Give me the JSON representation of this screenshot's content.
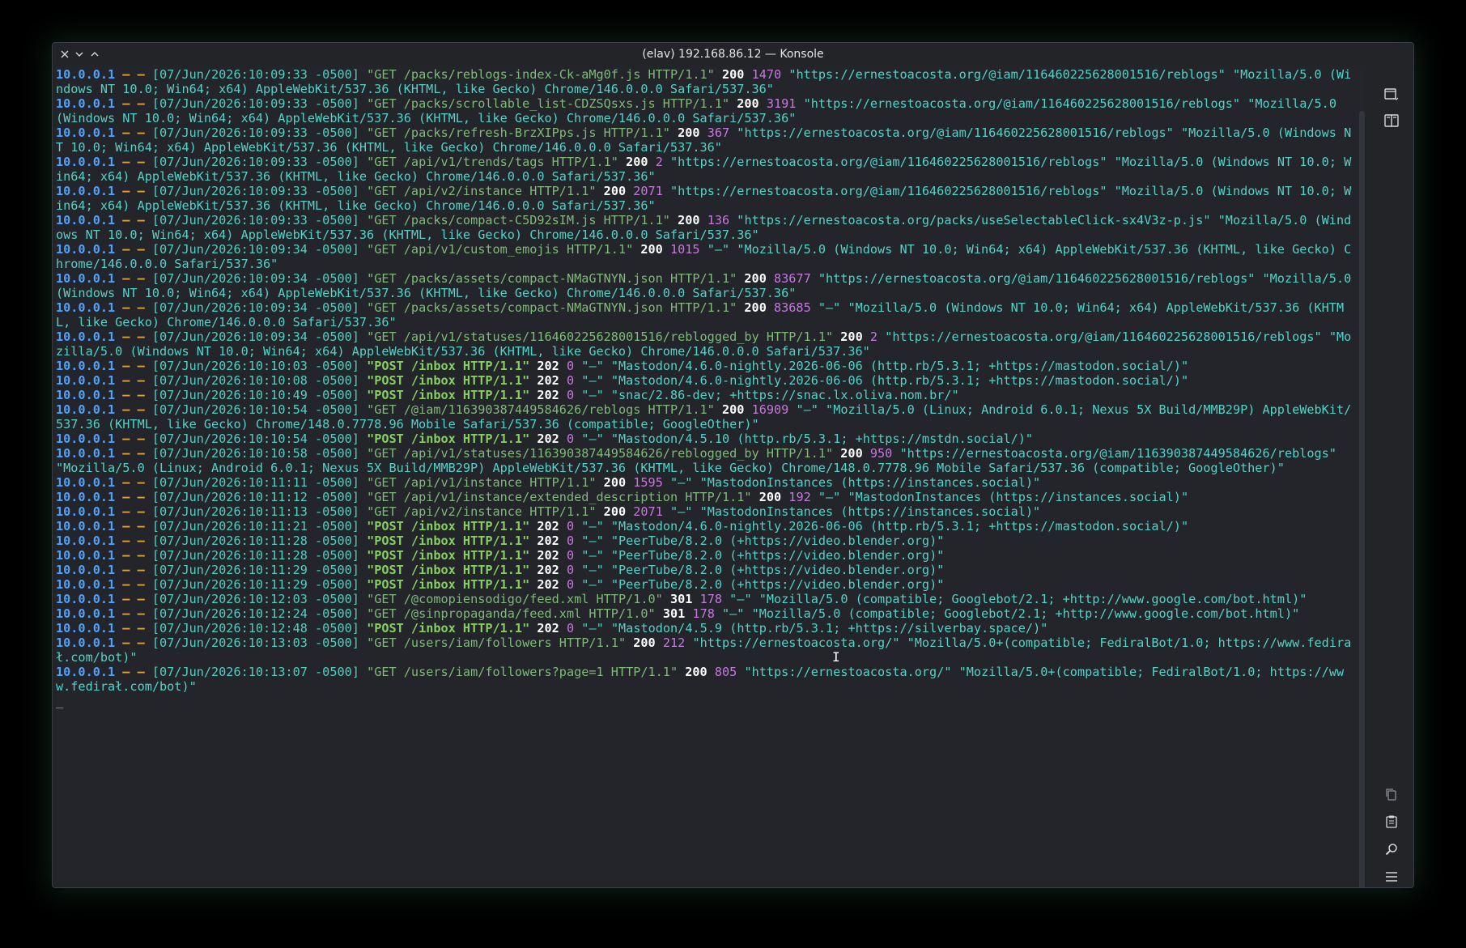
{
  "window": {
    "title": "(elav) 192.168.86.12 — Konsole"
  },
  "log_lines": [
    {
      "ip": "10.0.0.1",
      "sep": " – – ",
      "ts": "[07/Jun/2026:10:09:33 -0500]",
      "req": "\"GET /packs/reblogs-index-Ck-aMg0f.js HTTP/1.1\"",
      "method": "GET",
      "status": "200",
      "size": "1470",
      "ref": "\"https://ernestoacosta.org/@iam/116460225628001516/reblogs\"",
      "ua": "\"Mozilla/5.0 (Windows NT 10.0; Win64; x64) AppleWebKit/537.36 (KHTML, like Gecko) Chrome/146.0.0.0 Safari/537.36\""
    },
    {
      "ip": "10.0.0.1",
      "sep": " – – ",
      "ts": "[07/Jun/2026:10:09:33 -0500]",
      "req": "\"GET /packs/scrollable_list-CDZSQsxs.js HTTP/1.1\"",
      "method": "GET",
      "status": "200",
      "size": "3191",
      "ref": "\"https://ernestoacosta.org/@iam/116460225628001516/reblogs\"",
      "ua": "\"Mozilla/5.0 (Windows NT 10.0; Win64; x64) AppleWebKit/537.36 (KHTML, like Gecko) Chrome/146.0.0.0 Safari/537.36\""
    },
    {
      "ip": "10.0.0.1",
      "sep": " – – ",
      "ts": "[07/Jun/2026:10:09:33 -0500]",
      "req": "\"GET /packs/refresh-BrzXIPps.js HTTP/1.1\"",
      "method": "GET",
      "status": "200",
      "size": "367",
      "ref": "\"https://ernestoacosta.org/@iam/116460225628001516/reblogs\"",
      "ua": "\"Mozilla/5.0 (Windows NT 10.0; Win64; x64) AppleWebKit/537.36 (KHTML, like Gecko) Chrome/146.0.0.0 Safari/537.36\""
    },
    {
      "ip": "10.0.0.1",
      "sep": " – – ",
      "ts": "[07/Jun/2026:10:09:33 -0500]",
      "req": "\"GET /api/v1/trends/tags HTTP/1.1\"",
      "method": "GET",
      "status": "200",
      "size": "2",
      "ref": "\"https://ernestoacosta.org/@iam/116460225628001516/reblogs\"",
      "ua": "\"Mozilla/5.0 (Windows NT 10.0; Win64; x64) AppleWebKit/537.36 (KHTML, like Gecko) Chrome/146.0.0.0 Safari/537.36\""
    },
    {
      "ip": "10.0.0.1",
      "sep": " – – ",
      "ts": "[07/Jun/2026:10:09:33 -0500]",
      "req": "\"GET /api/v2/instance HTTP/1.1\"",
      "method": "GET",
      "status": "200",
      "size": "2071",
      "ref": "\"https://ernestoacosta.org/@iam/116460225628001516/reblogs\"",
      "ua": "\"Mozilla/5.0 (Windows NT 10.0; Win64; x64) AppleWebKit/537.36 (KHTML, like Gecko) Chrome/146.0.0.0 Safari/537.36\""
    },
    {
      "ip": "10.0.0.1",
      "sep": " – – ",
      "ts": "[07/Jun/2026:10:09:33 -0500]",
      "req": "\"GET /packs/compact-C5D92sIM.js HTTP/1.1\"",
      "method": "GET",
      "status": "200",
      "size": "136",
      "ref": "\"https://ernestoacosta.org/packs/useSelectableClick-sx4V3z-p.js\"",
      "ua": "\"Mozilla/5.0 (Windows NT 10.0; Win64; x64) AppleWebKit/537.36 (KHTML, like Gecko) Chrome/146.0.0.0 Safari/537.36\""
    },
    {
      "ip": "10.0.0.1",
      "sep": " – – ",
      "ts": "[07/Jun/2026:10:09:34 -0500]",
      "req": "\"GET /api/v1/custom_emojis HTTP/1.1\"",
      "method": "GET",
      "status": "200",
      "size": "1015",
      "ref": "\"–\"",
      "ua": "\"Mozilla/5.0 (Windows NT 10.0; Win64; x64) AppleWebKit/537.36 (KHTML, like Gecko) Chrome/146.0.0.0 Safari/537.36\""
    },
    {
      "ip": "10.0.0.1",
      "sep": " – – ",
      "ts": "[07/Jun/2026:10:09:34 -0500]",
      "req": "\"GET /packs/assets/compact-NMaGTNYN.json HTTP/1.1\"",
      "method": "GET",
      "status": "200",
      "size": "83677",
      "ref": "\"https://ernestoacosta.org/@iam/116460225628001516/reblogs\"",
      "ua": "\"Mozilla/5.0 (Windows NT 10.0; Win64; x64) AppleWebKit/537.36 (KHTML, like Gecko) Chrome/146.0.0.0 Safari/537.36\""
    },
    {
      "ip": "10.0.0.1",
      "sep": " – – ",
      "ts": "[07/Jun/2026:10:09:34 -0500]",
      "req": "\"GET /packs/assets/compact-NMaGTNYN.json HTTP/1.1\"",
      "method": "GET",
      "status": "200",
      "size": "83685",
      "ref": "\"–\"",
      "ua": "\"Mozilla/5.0 (Windows NT 10.0; Win64; x64) AppleWebKit/537.36 (KHTML, like Gecko) Chrome/146.0.0.0 Safari/537.36\""
    },
    {
      "ip": "10.0.0.1",
      "sep": " – – ",
      "ts": "[07/Jun/2026:10:09:34 -0500]",
      "req": "\"GET /api/v1/statuses/116460225628001516/reblogged_by HTTP/1.1\"",
      "method": "GET",
      "status": "200",
      "size": "2",
      "ref": "\"https://ernestoacosta.org/@iam/116460225628001516/reblogs\"",
      "ua": "\"Mozilla/5.0 (Windows NT 10.0; Win64; x64) AppleWebKit/537.36 (KHTML, like Gecko) Chrome/146.0.0.0 Safari/537.36\""
    },
    {
      "ip": "10.0.0.1",
      "sep": " – – ",
      "ts": "[07/Jun/2026:10:10:03 -0500]",
      "req": "\"POST /inbox HTTP/1.1\"",
      "method": "POST",
      "status": "202",
      "size": "0",
      "ref": "\"–\"",
      "ua": "\"Mastodon/4.6.0-nightly.2026-06-06 (http.rb/5.3.1; +https://mastodon.social/)\""
    },
    {
      "ip": "10.0.0.1",
      "sep": " – – ",
      "ts": "[07/Jun/2026:10:10:08 -0500]",
      "req": "\"POST /inbox HTTP/1.1\"",
      "method": "POST",
      "status": "202",
      "size": "0",
      "ref": "\"–\"",
      "ua": "\"Mastodon/4.6.0-nightly.2026-06-06 (http.rb/5.3.1; +https://mastodon.social/)\""
    },
    {
      "ip": "10.0.0.1",
      "sep": " – – ",
      "ts": "[07/Jun/2026:10:10:49 -0500]",
      "req": "\"POST /inbox HTTP/1.1\"",
      "method": "POST",
      "status": "202",
      "size": "0",
      "ref": "\"–\"",
      "ua": "\"snac/2.86-dev; +https://snac.lx.oliva.nom.br/\""
    },
    {
      "ip": "10.0.0.1",
      "sep": " – – ",
      "ts": "[07/Jun/2026:10:10:54 -0500]",
      "req": "\"GET /@iam/116390387449584626/reblogs HTTP/1.1\"",
      "method": "GET",
      "status": "200",
      "size": "16909",
      "ref": "\"–\"",
      "ua": "\"Mozilla/5.0 (Linux; Android 6.0.1; Nexus 5X Build/MMB29P) AppleWebKit/537.36 (KHTML, like Gecko) Chrome/148.0.7778.96 Mobile Safari/537.36 (compatible; GoogleOther)\""
    },
    {
      "ip": "10.0.0.1",
      "sep": " – – ",
      "ts": "[07/Jun/2026:10:10:54 -0500]",
      "req": "\"POST /inbox HTTP/1.1\"",
      "method": "POST",
      "status": "202",
      "size": "0",
      "ref": "\"–\"",
      "ua": "\"Mastodon/4.5.10 (http.rb/5.3.1; +https://mstdn.social/)\""
    },
    {
      "ip": "10.0.0.1",
      "sep": " – – ",
      "ts": "[07/Jun/2026:10:10:58 -0500]",
      "req": "\"GET /api/v1/statuses/116390387449584626/reblogged_by HTTP/1.1\"",
      "method": "GET",
      "status": "200",
      "size": "950",
      "ref": "\"https://ernestoacosta.org/@iam/116390387449584626/reblogs\"",
      "ua": "\"Mozilla/5.0 (Linux; Android 6.0.1; Nexus 5X Build/MMB29P) AppleWebKit/537.36 (KHTML, like Gecko) Chrome/148.0.7778.96 Mobile Safari/537.36 (compatible; GoogleOther)\""
    },
    {
      "ip": "10.0.0.1",
      "sep": " – – ",
      "ts": "[07/Jun/2026:10:11:11 -0500]",
      "req": "\"GET /api/v1/instance HTTP/1.1\"",
      "method": "GET",
      "status": "200",
      "size": "1595",
      "ref": "\"–\"",
      "ua": "\"MastodonInstances (https://instances.social)\""
    },
    {
      "ip": "10.0.0.1",
      "sep": " – – ",
      "ts": "[07/Jun/2026:10:11:12 -0500]",
      "req": "\"GET /api/v1/instance/extended_description HTTP/1.1\"",
      "method": "GET",
      "status": "200",
      "size": "192",
      "ref": "\"–\"",
      "ua": "\"MastodonInstances (https://instances.social)\""
    },
    {
      "ip": "10.0.0.1",
      "sep": " – – ",
      "ts": "[07/Jun/2026:10:11:13 -0500]",
      "req": "\"GET /api/v2/instance HTTP/1.1\"",
      "method": "GET",
      "status": "200",
      "size": "2071",
      "ref": "\"–\"",
      "ua": "\"MastodonInstances (https://instances.social)\""
    },
    {
      "ip": "10.0.0.1",
      "sep": " – – ",
      "ts": "[07/Jun/2026:10:11:21 -0500]",
      "req": "\"POST /inbox HTTP/1.1\"",
      "method": "POST",
      "status": "202",
      "size": "0",
      "ref": "\"–\"",
      "ua": "\"Mastodon/4.6.0-nightly.2026-06-06 (http.rb/5.3.1; +https://mastodon.social/)\""
    },
    {
      "ip": "10.0.0.1",
      "sep": " – – ",
      "ts": "[07/Jun/2026:10:11:28 -0500]",
      "req": "\"POST /inbox HTTP/1.1\"",
      "method": "POST",
      "status": "202",
      "size": "0",
      "ref": "\"–\"",
      "ua": "\"PeerTube/8.2.0 (+https://video.blender.org)\""
    },
    {
      "ip": "10.0.0.1",
      "sep": " – – ",
      "ts": "[07/Jun/2026:10:11:28 -0500]",
      "req": "\"POST /inbox HTTP/1.1\"",
      "method": "POST",
      "status": "202",
      "size": "0",
      "ref": "\"–\"",
      "ua": "\"PeerTube/8.2.0 (+https://video.blender.org)\""
    },
    {
      "ip": "10.0.0.1",
      "sep": " – – ",
      "ts": "[07/Jun/2026:10:11:29 -0500]",
      "req": "\"POST /inbox HTTP/1.1\"",
      "method": "POST",
      "status": "202",
      "size": "0",
      "ref": "\"–\"",
      "ua": "\"PeerTube/8.2.0 (+https://video.blender.org)\""
    },
    {
      "ip": "10.0.0.1",
      "sep": " – – ",
      "ts": "[07/Jun/2026:10:11:29 -0500]",
      "req": "\"POST /inbox HTTP/1.1\"",
      "method": "POST",
      "status": "202",
      "size": "0",
      "ref": "\"–\"",
      "ua": "\"PeerTube/8.2.0 (+https://video.blender.org)\""
    },
    {
      "ip": "10.0.0.1",
      "sep": " – – ",
      "ts": "[07/Jun/2026:10:12:03 -0500]",
      "req": "\"GET /@comopiensodigo/feed.xml HTTP/1.0\"",
      "method": "GET",
      "status": "301",
      "size": "178",
      "ref": "\"–\"",
      "ua": "\"Mozilla/5.0 (compatible; Googlebot/2.1; +http://www.google.com/bot.html)\""
    },
    {
      "ip": "10.0.0.1",
      "sep": " – – ",
      "ts": "[07/Jun/2026:10:12:24 -0500]",
      "req": "\"GET /@sinpropaganda/feed.xml HTTP/1.0\"",
      "method": "GET",
      "status": "301",
      "size": "178",
      "ref": "\"–\"",
      "ua": "\"Mozilla/5.0 (compatible; Googlebot/2.1; +http://www.google.com/bot.html)\""
    },
    {
      "ip": "10.0.0.1",
      "sep": " – – ",
      "ts": "[07/Jun/2026:10:12:48 -0500]",
      "req": "\"POST /inbox HTTP/1.1\"",
      "method": "POST",
      "status": "202",
      "size": "0",
      "ref": "\"–\"",
      "ua": "\"Mastodon/4.5.9 (http.rb/5.3.1; +https://silverbay.space/)\""
    },
    {
      "ip": "10.0.0.1",
      "sep": " – – ",
      "ts": "[07/Jun/2026:10:13:03 -0500]",
      "req": "\"GET /users/iam/followers HTTP/1.1\"",
      "method": "GET",
      "status": "200",
      "size": "212",
      "ref": "\"https://ernestoacosta.org/\"",
      "ua": "\"Mozilla/5.0+(compatible; FediralBot/1.0; https://www.fedirał.com/bot)\""
    },
    {
      "ip": "10.0.0.1",
      "sep": " – – ",
      "ts": "[07/Jun/2026:10:13:07 -0500]",
      "req": "\"GET /users/iam/followers?page=1 HTTP/1.1\"",
      "method": "GET",
      "status": "200",
      "size": "805",
      "ref": "\"https://ernestoacosta.org/\"",
      "ua": "\"Mozilla/5.0+(compatible; FediralBot/1.0; https://www.fedirał.com/bot)\""
    }
  ],
  "prompt_cursor": "_",
  "mouse_cursor_glyph": "I",
  "icons": {
    "window_close": "close-icon",
    "window_minimize": "chevron-down-icon",
    "window_maximize": "chevron-up-icon",
    "sidebar_top": [
      "new-tab-icon",
      "split-view-icon"
    ],
    "sidebar_bottom": [
      "copy-icon",
      "paste-icon",
      "search-icon",
      "menu-icon"
    ]
  },
  "colors": {
    "ip": "#4da3ff",
    "dash": "#e0a437",
    "timestamp": "#4fd0c0",
    "get_request": "#7fba7a",
    "post_request": "#86d15e",
    "status": "#ffffff",
    "size": "#c678dd",
    "referrer": "#53d3c8",
    "background": "#23252a"
  }
}
